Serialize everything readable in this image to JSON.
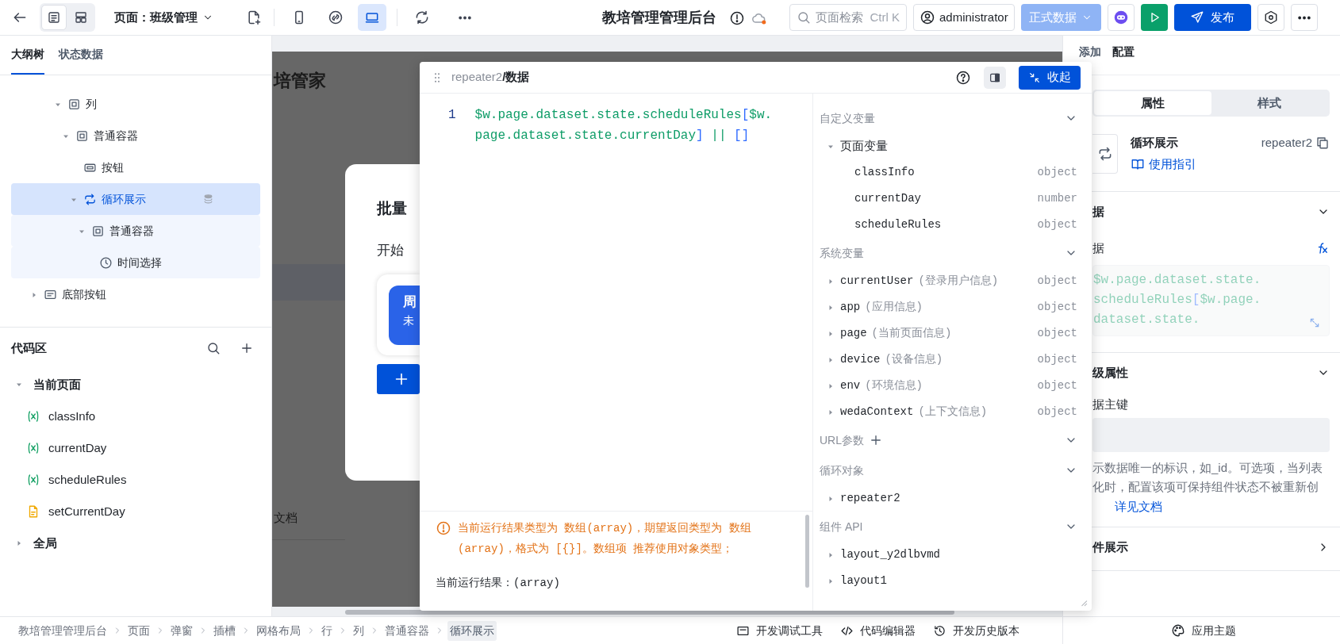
{
  "header": {
    "view_modes": [
      {
        "kind": "outline",
        "selected": true
      },
      {
        "kind": "layout",
        "selected": false
      }
    ],
    "page_selector": "页面：班级管理",
    "devices": [
      {
        "kind": "phone",
        "selected": false
      },
      {
        "kind": "adaptive",
        "selected": false
      },
      {
        "kind": "desktop",
        "selected": true
      }
    ],
    "app_title": "教培管理管理后台",
    "search": {
      "placeholder": "页面检索",
      "shortcut": "Ctrl K"
    },
    "user": "administrator",
    "environment": {
      "label": "正式数据",
      "disabled": true
    },
    "publish": "发布"
  },
  "left_panel": {
    "tabs": [
      {
        "label": "大纲树",
        "selected": true
      },
      {
        "label": "状态数据",
        "selected": false
      }
    ],
    "outline": [
      {
        "children": [
          {
            "children": [
              {
                "children": [
                  {
                    "label": "列",
                    "kind": "container",
                    "expanded": true,
                    "selected": false,
                    "children": [
                      {
                        "label": "普通容器",
                        "kind": "container",
                        "expanded": true,
                        "selected": false,
                        "children": [
                          {
                            "label": "按钮",
                            "kind": "button",
                            "selected": false
                          },
                          {
                            "label": "循环展示",
                            "kind": "repeater",
                            "expanded": true,
                            "selected": true,
                            "data_bound": true,
                            "children": [
                              {
                                "label": "普通容器",
                                "kind": "container",
                                "expanded": true,
                                "selected": false,
                                "children": [
                                  {
                                    "label": "时间选择",
                                    "kind": "time",
                                    "selected": false
                                  }
                                ]
                              }
                            ]
                          }
                        ]
                      }
                    ]
                  }
                ]
              }
            ]
          }
        ]
      },
      {
        "label": "底部按钮",
        "kind": "footer",
        "expanded": false,
        "selected": false
      }
    ],
    "code_area": {
      "title": "代码区",
      "groups": [
        {
          "label": "当前页面",
          "expanded": true,
          "items": [
            {
              "kind": "variable",
              "label": "classInfo"
            },
            {
              "kind": "variable",
              "label": "currentDay"
            },
            {
              "kind": "variable",
              "label": "scheduleRules"
            },
            {
              "kind": "function",
              "label": "setCurrentDay"
            }
          ]
        },
        {
          "label": "全局",
          "expanded": false
        }
      ]
    }
  },
  "canvas": {
    "page_title": "培管家",
    "dialog_title": "批量",
    "start_label": "开始",
    "day_card": {
      "day": "周",
      "status": "未"
    },
    "footer_link": "文档"
  },
  "popup": {
    "path": "repeater2",
    "title": "/数据",
    "collapse": "收起",
    "code": [
      {
        "number": "1",
        "tokens": [
          {
            "text": "$w.page.dataset.state.scheduleRules",
            "kind": "identifier"
          },
          {
            "text": "[",
            "kind": "bracket"
          },
          {
            "text": "$w.page.dataset.state.currentDay",
            "kind": "identifier"
          },
          {
            "text": "]",
            "kind": "bracket"
          },
          {
            "text": " || ",
            "kind": "operator"
          },
          {
            "text": "[]",
            "kind": "bracket"
          }
        ]
      }
    ],
    "warning": "当前运行结果类型为 数组(array)，期望返回类型为 数组(array)，格式为 [{}]。数组项 推荐使用对象类型；",
    "output": "当前运行结果：(array)",
    "variables": [
      {
        "title": "自定义变量",
        "expanded": true,
        "items": [
          {
            "label": "页面变量",
            "expanded": true,
            "children": [
              {
                "label": "classInfo",
                "type": "object"
              },
              {
                "label": "currentDay",
                "type": "number"
              },
              {
                "label": "scheduleRules",
                "type": "object"
              }
            ]
          }
        ]
      },
      {
        "title": "系统变量",
        "expanded": true,
        "items": [
          {
            "label": "currentUser",
            "note": "(登录用户信息)",
            "type": "object",
            "expanded": false
          },
          {
            "label": "app",
            "note": "(应用信息)",
            "type": "object",
            "expanded": false
          },
          {
            "label": "page",
            "note": "(当前页面信息)",
            "type": "object",
            "expanded": false
          },
          {
            "label": "device",
            "note": "(设备信息)",
            "type": "object",
            "expanded": false
          },
          {
            "label": "env",
            "note": "(环境信息)",
            "type": "object",
            "expanded": false
          },
          {
            "label": "wedaContext",
            "note": "(上下文信息)",
            "type": "object",
            "expanded": false
          }
        ]
      },
      {
        "title": "URL参数",
        "addable": true,
        "expanded": true
      },
      {
        "title": "循环对象",
        "expanded": true,
        "items": [
          {
            "label": "repeater2",
            "expanded": false
          }
        ]
      },
      {
        "title": "组件 API",
        "expanded": true,
        "items": [
          {
            "label": "layout_y2dlbvmd",
            "expanded": false
          },
          {
            "label": "layout1",
            "expanded": false
          }
        ]
      }
    ]
  },
  "right_panel": {
    "tabs": [
      {
        "label": "添加",
        "selected": false
      },
      {
        "label": "配置",
        "selected": true
      }
    ],
    "segments": [
      {
        "label": "属性",
        "selected": true
      },
      {
        "label": "样式",
        "selected": false
      }
    ],
    "component": {
      "name": "循环展示",
      "id": "repeater2",
      "guide": "使用指引"
    },
    "sections": [
      {
        "kind": "expression",
        "title": "据",
        "expanded": true,
        "field_label": "据",
        "preview": [
          [
            {
              "text": "$w.page.dataset.state.",
              "kind": "identifier"
            }
          ],
          [
            {
              "text": "scheduleRules",
              "kind": "identifier"
            },
            {
              "text": "[",
              "kind": "bracket"
            },
            {
              "text": "$w.page.",
              "kind": "identifier"
            }
          ],
          [
            {
              "text": "dataset.state.",
              "kind": "identifier"
            }
          ]
        ]
      },
      {
        "kind": "key",
        "title": "级属性",
        "expanded": true,
        "field_label": "据主键",
        "help": [
          "示数据唯一的标识，如_id。可选项，当列表",
          "化时，配置该项可保持组件状态不被重新创"
        ],
        "link": "详见文档"
      },
      {
        "kind": "plain",
        "title": "件展示",
        "expanded": false
      }
    ]
  },
  "status_bar": {
    "breadcrumbs": [
      {
        "label": "教培管理管理后台",
        "selected": false
      },
      {
        "label": "页面",
        "selected": false
      },
      {
        "label": "弹窗",
        "selected": false
      },
      {
        "label": "插槽",
        "selected": false
      },
      {
        "label": "网格布局",
        "selected": false
      },
      {
        "label": "行",
        "selected": false
      },
      {
        "label": "列",
        "selected": false
      },
      {
        "label": "普通容器",
        "selected": false
      },
      {
        "label": "循环展示",
        "selected": true
      }
    ],
    "tools": [
      {
        "kind": "debug",
        "label": "开发调试工具"
      },
      {
        "kind": "code",
        "label": "代码编辑器"
      },
      {
        "kind": "history",
        "label": "开发历史版本"
      }
    ],
    "theme": "应用主题"
  }
}
